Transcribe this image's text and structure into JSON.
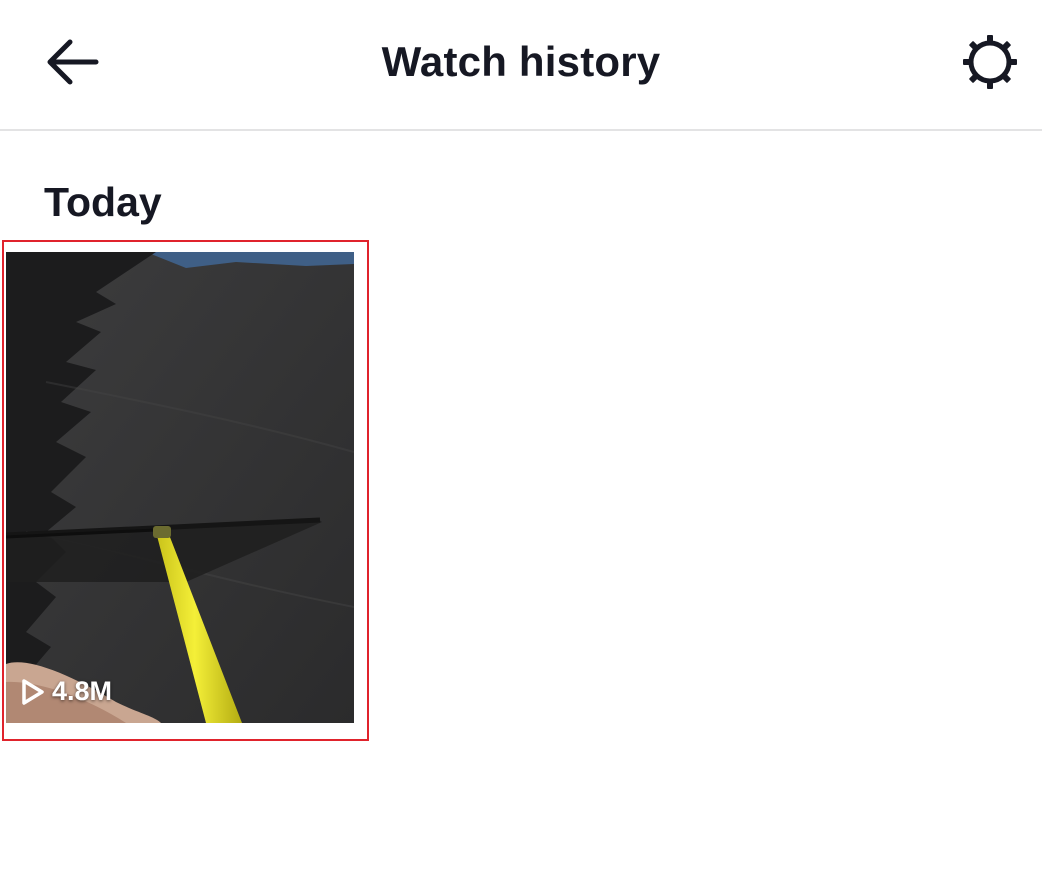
{
  "header": {
    "title": "Watch history",
    "back_icon": "arrow-left-icon",
    "settings_icon": "gear-icon"
  },
  "sections": [
    {
      "title": "Today",
      "videos": [
        {
          "views": "4.8M",
          "play_icon": "play-outline-icon"
        }
      ]
    }
  ],
  "colors": {
    "text": "#161823",
    "divider": "#e3e3e4",
    "highlight": "#e0232c",
    "view_count": "#ffffff"
  }
}
